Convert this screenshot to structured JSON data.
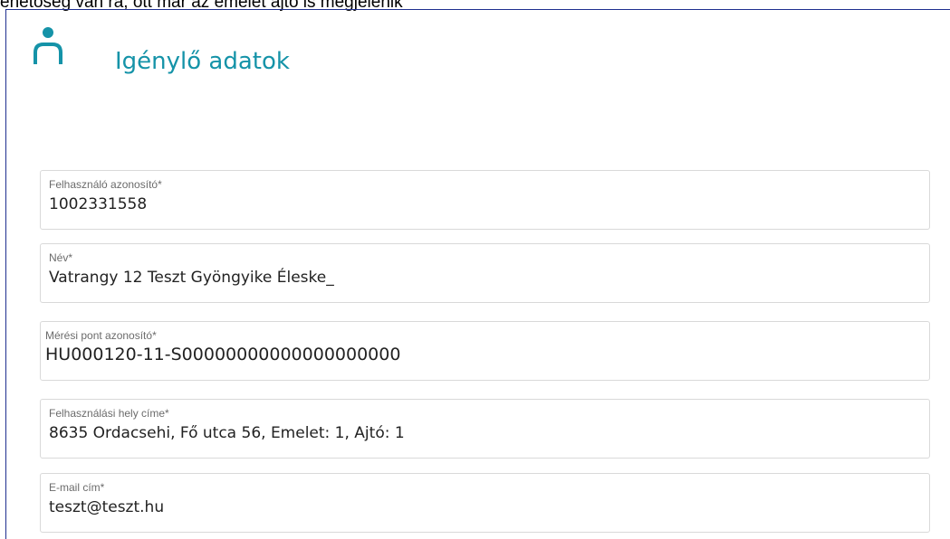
{
  "caption": "ehetőség van rá, ott már az emelet ajtó is megjelenik",
  "header": {
    "icon": "user-icon",
    "title": "Igénylő adatok"
  },
  "fields": [
    {
      "label": "Felhasználó azonosító*",
      "value": "1002331558"
    },
    {
      "label": "Név*",
      "value": "Vatrangy 12 Teszt Gyöngyike Éleske_"
    },
    {
      "label": "Mérési pont azonosító*",
      "value": "HU000120-11-S00000000000000000000"
    },
    {
      "label": "Felhasználási hely címe*",
      "value": "8635 Ordacsehi, Fő utca 56, Emelet: 1, Ajtó: 1"
    },
    {
      "label": "E-mail cím*",
      "value": "teszt@teszt.hu"
    }
  ],
  "colors": {
    "accent": "#1593a8",
    "frame_border": "#1f2f8f",
    "field_border": "#d9d9d9",
    "label_text": "#6b6b6b",
    "value_text": "#222222"
  }
}
